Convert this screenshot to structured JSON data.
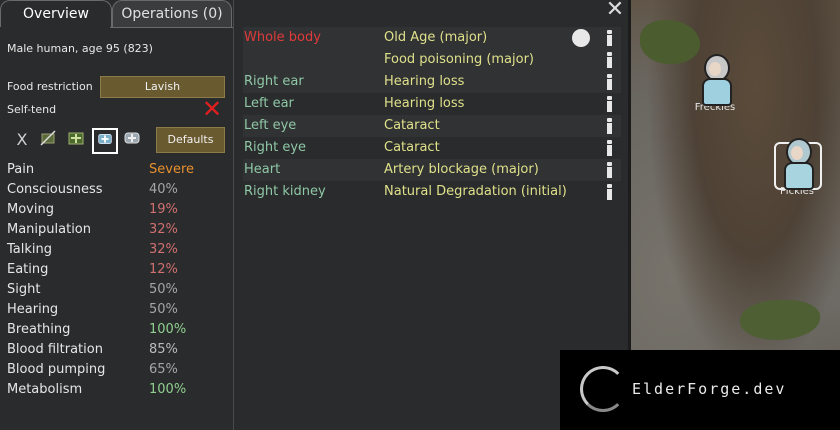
{
  "tabs": {
    "overview": "Overview",
    "operations": "Operations (0)"
  },
  "pawn": {
    "description": "Male human, age 95 (823)"
  },
  "food_restriction": {
    "label": "Food restriction",
    "value": "Lavish"
  },
  "self_tend": {
    "label": "Self-tend",
    "state_icon": "red-x-icon"
  },
  "medical_care": {
    "icons": [
      "no-care-x-icon",
      "no-meds-icon",
      "herbal-medicine-icon",
      "industrial-medicine-icon",
      "glitterworld-medicine-icon"
    ],
    "x_glyph": "X",
    "defaults_label": "Defaults"
  },
  "capacities": [
    {
      "name": "Pain",
      "value": "Severe",
      "color": "#e8902e"
    },
    {
      "name": "Consciousness",
      "value": "40%",
      "color": "#a6a6a6"
    },
    {
      "name": "Moving",
      "value": "19%",
      "color": "#d07070"
    },
    {
      "name": "Manipulation",
      "value": "32%",
      "color": "#d07070"
    },
    {
      "name": "Talking",
      "value": "32%",
      "color": "#d07070"
    },
    {
      "name": "Eating",
      "value": "12%",
      "color": "#d07070"
    },
    {
      "name": "Sight",
      "value": "50%",
      "color": "#a6a6a6"
    },
    {
      "name": "Hearing",
      "value": "50%",
      "color": "#a6a6a6"
    },
    {
      "name": "Breathing",
      "value": "100%",
      "color": "#8fd08f"
    },
    {
      "name": "Blood filtration",
      "value": "85%",
      "color": "#bcbcbc"
    },
    {
      "name": "Blood pumping",
      "value": "65%",
      "color": "#a6a6a6"
    },
    {
      "name": "Metabolism",
      "value": "100%",
      "color": "#8fd08f"
    }
  ],
  "hediffs": [
    {
      "part": "Whole body",
      "part_color": "#e03a3a",
      "condition": "Old Age (major)"
    },
    {
      "part": "",
      "part_color": "#e03a3a",
      "condition": "Food poisoning (major)"
    },
    {
      "part": "Right ear",
      "part_color": "#8fc8a6",
      "condition": "Hearing loss"
    },
    {
      "part": "Left ear",
      "part_color": "#8fc8a6",
      "condition": "Hearing loss"
    },
    {
      "part": "Left eye",
      "part_color": "#8fc8a6",
      "condition": "Cataract"
    },
    {
      "part": "Right eye",
      "part_color": "#8fc8a6",
      "condition": "Cataract"
    },
    {
      "part": "Heart",
      "part_color": "#8fc8a6",
      "condition": "Artery blockage (major)"
    },
    {
      "part": "Right kidney",
      "part_color": "#8fc8a6",
      "condition": "Natural Degradation (initial)"
    }
  ],
  "map": {
    "pawns": [
      {
        "name": "Freckles"
      },
      {
        "name": "Pickles"
      }
    ]
  },
  "watermark": {
    "text": "ElderForge.dev"
  },
  "close_icon": "close-icon",
  "close_glyph": "✕"
}
